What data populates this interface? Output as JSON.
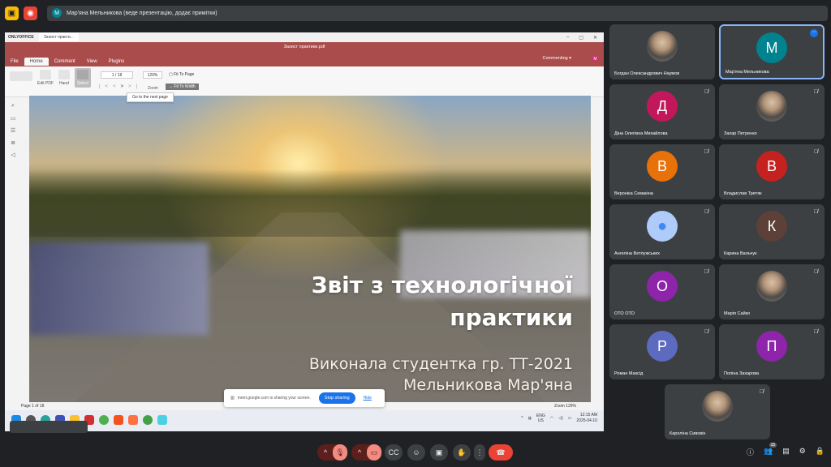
{
  "topbar": {
    "presenter_initial": "M",
    "presenter_text": "Мар'яна Мельникова (веде презентацію, додає примітки)"
  },
  "editor": {
    "app_name": "ONLYOFFICE",
    "tab_name": "Захист практи...",
    "doc_title": "Захист практики.pdf",
    "menu": [
      "File",
      "Home",
      "Comment",
      "View",
      "Plugins"
    ],
    "mode": "Commenting",
    "tools": {
      "edit_pdf": "Edit PDF",
      "hand": "Hand",
      "select": "Select",
      "page_input": "1 / 18",
      "zoom_input": "129%",
      "zoom_label": "Zoom",
      "fit_page": "Fit To Page",
      "fit_width": "Fit To Width",
      "tooltip": "Go to the next page"
    },
    "status": {
      "page": "Page 1 of 18",
      "zoom": "Zoom 129%"
    }
  },
  "slide": {
    "title_line1": "Звіт з технологічної",
    "title_line2": "практики",
    "sub_line1": "Виконала студентка гр. ТТ-2021",
    "sub_line2": "Мельникова Мар'яна"
  },
  "share_bar": {
    "text": "meet.google.com is sharing your screen.",
    "stop": "Stop sharing",
    "hide": "Hide"
  },
  "taskbar": {
    "lang_top": "ENG",
    "lang_bottom": "US",
    "time": "12:15 AM",
    "date": "2025-04-10"
  },
  "participants": [
    {
      "name": "Богдан Олександрович Наумов",
      "initial": "",
      "color": "",
      "photo": true
    },
    {
      "name": "Мар'яна Мельникова",
      "initial": "М",
      "color": "#00838f",
      "speaking": true
    },
    {
      "name": "Діна Олегівна Михайлова",
      "initial": "Д",
      "color": "#c2185b"
    },
    {
      "name": "Захар Петренко",
      "initial": "",
      "color": "",
      "photo": true
    },
    {
      "name": "Вероніка Семакіна",
      "initial": "В",
      "color": "#e8710a"
    },
    {
      "name": "Владислав Третяк",
      "initial": "В",
      "color": "#c5221f"
    },
    {
      "name": "Ангеліна Ветлужських",
      "initial": "",
      "color": "#aecbfa"
    },
    {
      "name": "Карина Вальчук",
      "initial": "К",
      "color": "#5d4037"
    },
    {
      "name": "ОТО ОТО",
      "initial": "О",
      "color": "#8e24aa"
    },
    {
      "name": "Марія Сайко",
      "initial": "",
      "color": "",
      "photo": true
    },
    {
      "name": "Роман Максід",
      "initial": "Р",
      "color": "#5c6bc0"
    },
    {
      "name": "Поліна Захарова",
      "initial": "П",
      "color": "#8e24aa"
    },
    {
      "name": "Кароліна Сивовін",
      "initial": "",
      "color": "",
      "photo": true
    }
  ],
  "controls": {
    "participants_count": "15"
  }
}
